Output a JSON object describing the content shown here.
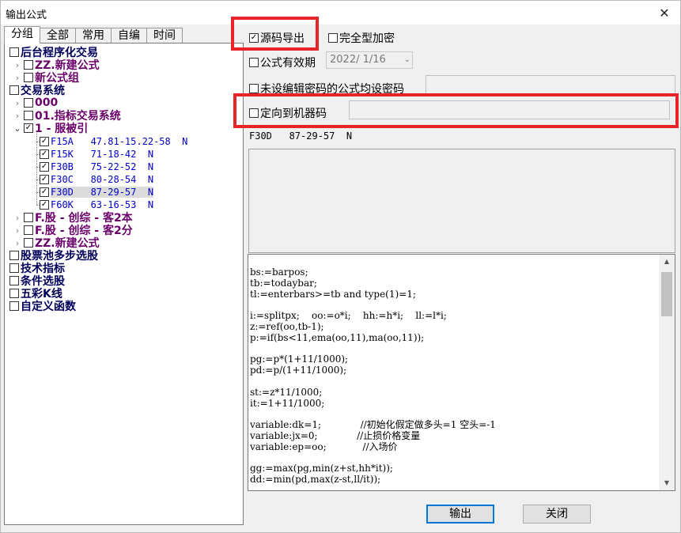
{
  "window": {
    "title": "输出公式",
    "close_glyph": "✕"
  },
  "tabs": [
    {
      "label": "分组",
      "active": true
    },
    {
      "label": "全部"
    },
    {
      "label": "常用"
    },
    {
      "label": "自编"
    },
    {
      "label": "时间"
    }
  ],
  "tree": {
    "r1": "后台程序化交易",
    "r1c1": "ZZ.新建公式",
    "r1c2": "新公式组",
    "r2": "交易系统",
    "r2c1": "000",
    "r2c2": "01.指标交易系统",
    "r2c3": "1 - 服被引",
    "leaves": [
      {
        "label": "F15A   47.81-15.22-58  N"
      },
      {
        "label": "F15K   71-18-42  N"
      },
      {
        "label": "F30B   75-22-52  N"
      },
      {
        "label": "F30C   80-28-54  N"
      },
      {
        "label": "F30D   87-29-57  N"
      },
      {
        "label": "F60K   63-16-53  N"
      }
    ],
    "r2c4": "F.股 - 创综 - 客2本",
    "r2c5": "F.股 - 创综 - 客2分",
    "r2c6": "ZZ.新建公式",
    "r3": "股票池多步选股",
    "r4": "技术指标",
    "r5": "条件选股",
    "r6": "五彩K线",
    "r7": "自定义函数"
  },
  "options": {
    "source_export": "源码导出",
    "full_encrypt": "完全型加密",
    "valid_period": "公式有效期",
    "valid_date": "2022/ 1/16",
    "no_pwd": "未设编辑密码的公式均设密码",
    "machine_code": "定向到机器码"
  },
  "selected_formula": "F30D   87-29-57  N",
  "code_lines": [
    "bs:=barpos;",
    "tb:=todaybar;",
    "tl:=enterbars>=tb and type(1)=1;",
    "",
    "i:=splitpx;    oo:=o*i;    hh:=h*i;    ll:=l*i;",
    "z:=ref(oo,tb-1);",
    "p:=if(bs<11,ema(oo,11),ma(oo,11));",
    "",
    "pg:=p*(1+11/1000);",
    "pd:=p/(1+11/1000);",
    "",
    "st:=z*11/1000;",
    "it:=1+11/1000;",
    "",
    "variable:dk=1;             //初始化假定做多头=1 空头=-1",
    "variable:jx=0;             //止损价格变量",
    "variable:ep=oo;            //入场价",
    "",
    "gg:=max(pg,min(z+st,hh*it));",
    "dd:=min(pd,max(z-st,ll/it));"
  ],
  "buttons": {
    "output": "输出",
    "close": "关闭"
  }
}
